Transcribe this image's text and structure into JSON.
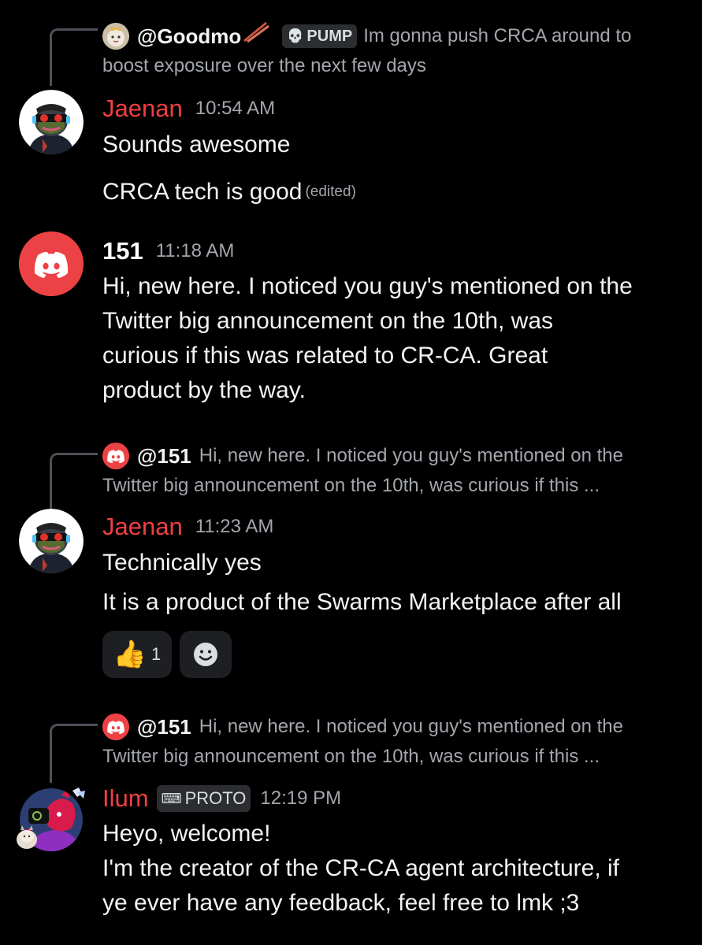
{
  "reply1": {
    "author": "@Goodmo",
    "author_icon": "chopsticks-icon",
    "tag": "PUMP",
    "tag_icon": "skull-icon",
    "text_line1": "Im gonna push CRCA around to",
    "text_line2": "boost exposure over the next few days"
  },
  "msg1": {
    "author": "Jaenan",
    "time": "10:54 AM",
    "lines": [
      "Sounds awesome",
      "CRCA tech is good"
    ],
    "edited": "(edited)"
  },
  "msg2": {
    "author": "151",
    "time": "11:18 AM",
    "lines": [
      "Hi, new here. I noticed you guy's mentioned on the",
      "Twitter big announcement on the 10th, was",
      "curious if this was related to CR-CA. Great",
      "product by the way."
    ]
  },
  "reply2": {
    "author": "@151",
    "text_line1": "Hi, new here. I noticed you guy's mentioned on the",
    "text_line2": "Twitter big announcement on the 10th, was curious if this ..."
  },
  "msg3": {
    "author": "Jaenan",
    "time": "11:23 AM",
    "lines": [
      "Technically yes",
      "It is a product of the Swarms Marketplace after all"
    ],
    "reactions": [
      {
        "emoji": "👍",
        "count": "1"
      },
      {
        "emoji": "add-reaction-icon",
        "count": ""
      }
    ]
  },
  "reply3": {
    "author": "@151",
    "text_line1": "Hi, new here. I noticed you guy's mentioned on the",
    "text_line2": "Twitter big announcement on the 10th, was curious if this ..."
  },
  "msg4": {
    "author": "Ilum",
    "tag": "PROTO",
    "tag_icon": "keyboard-hand-icon",
    "time": "12:19 PM",
    "lines": [
      "Heyo, welcome!",
      "I'm the creator of the CR-CA agent architecture, if",
      "ye ever have any feedback, feel free to lmk ;3"
    ]
  },
  "colors": {
    "background": "#000000",
    "username_red": "#f23f42",
    "discord_avatar_red": "#ed4245",
    "muted_text": "#a3a6ad"
  }
}
